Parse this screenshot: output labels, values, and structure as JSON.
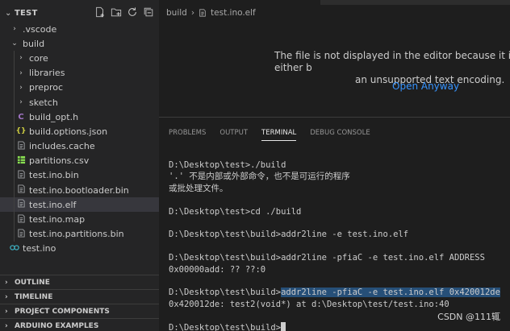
{
  "explorer": {
    "title": "TEST",
    "items": [
      {
        "label": ".vscode",
        "kind": "folder",
        "depth": 1,
        "state": "collapsed"
      },
      {
        "label": "build",
        "kind": "folder",
        "depth": 1,
        "state": "expanded"
      },
      {
        "label": "core",
        "kind": "folder",
        "depth": 2,
        "state": "collapsed"
      },
      {
        "label": "libraries",
        "kind": "folder",
        "depth": 2,
        "state": "collapsed"
      },
      {
        "label": "preproc",
        "kind": "folder",
        "depth": 2,
        "state": "collapsed"
      },
      {
        "label": "sketch",
        "kind": "folder",
        "depth": 2,
        "state": "collapsed"
      },
      {
        "label": "build_opt.h",
        "kind": "file",
        "depth": 2,
        "icon": "c-icon"
      },
      {
        "label": "build.options.json",
        "kind": "file",
        "depth": 2,
        "icon": "json-icon"
      },
      {
        "label": "includes.cache",
        "kind": "file",
        "depth": 2,
        "icon": "file-lines-icon"
      },
      {
        "label": "partitions.csv",
        "kind": "file",
        "depth": 2,
        "icon": "csv-icon"
      },
      {
        "label": "test.ino.bin",
        "kind": "file",
        "depth": 2,
        "icon": "file-lines-icon"
      },
      {
        "label": "test.ino.bootloader.bin",
        "kind": "file",
        "depth": 2,
        "icon": "file-lines-icon"
      },
      {
        "label": "test.ino.elf",
        "kind": "file",
        "depth": 2,
        "icon": "file-lines-icon",
        "selected": true
      },
      {
        "label": "test.ino.map",
        "kind": "file",
        "depth": 2,
        "icon": "file-lines-icon"
      },
      {
        "label": "test.ino.partitions.bin",
        "kind": "file",
        "depth": 2,
        "icon": "file-lines-icon"
      },
      {
        "label": "test.ino",
        "kind": "file",
        "depth": 1,
        "icon": "arduino-icon"
      }
    ],
    "sections": [
      "OUTLINE",
      "TIMELINE",
      "PROJECT COMPONENTS",
      "ARDUINO EXAMPLES"
    ]
  },
  "editor": {
    "breadcrumb": [
      "build",
      "test.ino.elf"
    ],
    "notice_line1": "The file is not displayed in the editor because it is either b",
    "notice_line2": "an unsupported text encoding.",
    "open_anyway": "Open Anyway"
  },
  "panel": {
    "tabs": [
      "PROBLEMS",
      "OUTPUT",
      "TERMINAL",
      "DEBUG CONSOLE"
    ],
    "active_tab": "TERMINAL"
  },
  "terminal": {
    "lines": [
      "D:\\Desktop\\test>./build",
      "'.' 不是内部或外部命令，也不是可运行的程序",
      "或批处理文件。",
      "",
      "D:\\Desktop\\test>cd ./build",
      "",
      "D:\\Desktop\\test\\build>addr2line -e test.ino.elf",
      "",
      "D:\\Desktop\\test\\build>addr2line -pfiaC -e test.ino.elf ADDRESS",
      "0x00000add: ?? ??:0",
      "",
      "D:\\Desktop\\test\\build>addr2line -pfiaC -e test.ino.elf 0x420012de",
      "0x420012de: test2(void*) at d:\\Desktop\\test/test.ino:40",
      "",
      "D:\\Desktop\\test\\build>"
    ],
    "highlight_prompt": "D:\\Desktop\\test\\build>",
    "highlight_text": "addr2line -pfiaC -e test.ino.elf 0x420012de"
  },
  "watermark": "CSDN @111辄",
  "colors": {
    "sidebar_bg": "#252526",
    "editor_bg": "#1e1e1e",
    "selected_row": "#37373d",
    "link": "#3794ff",
    "selection": "#264f78",
    "c_icon": "#a074c4",
    "json_icon": "#cbcb41",
    "csv_icon": "#89e051",
    "arduino_icon": "#3fb6c8"
  }
}
